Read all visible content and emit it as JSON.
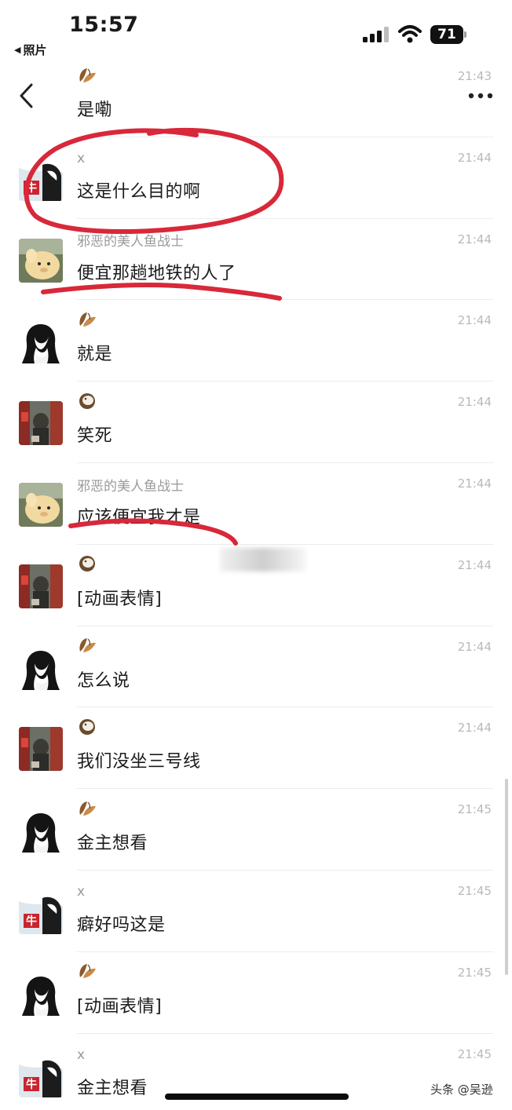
{
  "status_bar": {
    "time": "15:57",
    "back_app": "照片",
    "battery": "71"
  },
  "watermark": "头条 @吴逊",
  "messages": [
    {
      "avatar": "brown-leaf",
      "sender": "",
      "sender_icon": "brown-leaf-icon",
      "text": "是嘞",
      "time": "21:43",
      "nav_row": true
    },
    {
      "avatar": "cow-x",
      "sender": "x",
      "text": "这是什么目的啊",
      "time": "21:44"
    },
    {
      "avatar": "sheep",
      "sender": "邪恶的美人鱼战士",
      "text": "便宜那趟地铁的人了",
      "time": "21:44"
    },
    {
      "avatar": "anime-girl",
      "sender": "",
      "sender_icon": "brown-leaf-icon",
      "text": "就是",
      "time": "21:44"
    },
    {
      "avatar": "photo-red",
      "sender": "",
      "sender_icon": "coconut-icon",
      "text": "笑死",
      "time": "21:44"
    },
    {
      "avatar": "sheep",
      "sender": "邪恶的美人鱼战士",
      "text": "应该便宜我才是",
      "time": "21:44"
    },
    {
      "avatar": "photo-red",
      "sender": "",
      "sender_icon": "coconut-icon",
      "text": "[动画表情]",
      "time": "21:44"
    },
    {
      "avatar": "anime-girl",
      "sender": "",
      "sender_icon": "brown-leaf-icon",
      "text": "怎么说",
      "time": "21:44"
    },
    {
      "avatar": "photo-red",
      "sender": "",
      "sender_icon": "coconut-icon",
      "text": "我们没坐三号线",
      "time": "21:44"
    },
    {
      "avatar": "anime-girl",
      "sender": "",
      "sender_icon": "brown-leaf-icon",
      "text": "金主想看",
      "time": "21:45"
    },
    {
      "avatar": "cow-x",
      "sender": "x",
      "text": "癖好吗这是",
      "time": "21:45"
    },
    {
      "avatar": "anime-girl",
      "sender": "",
      "sender_icon": "brown-leaf-icon",
      "text": "[动画表情]",
      "time": "21:45"
    },
    {
      "avatar": "cow-x",
      "sender": "x",
      "text": "金主想看",
      "time": "21:45"
    }
  ],
  "colors": {
    "annotation_red": "#d8283a",
    "time_gray": "#b9b9b9",
    "sender_gray": "#9a9a9a",
    "divider": "#ececec"
  }
}
